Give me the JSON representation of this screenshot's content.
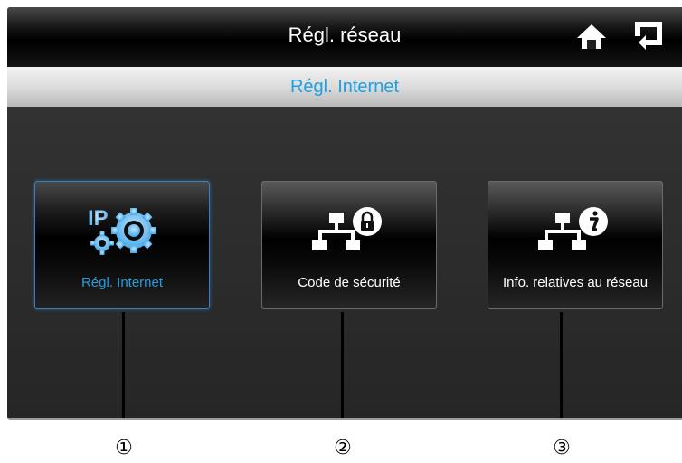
{
  "header": {
    "title": "Régl. réseau",
    "home_icon": "home-icon",
    "back_icon": "back-arrow-icon"
  },
  "subheader": {
    "title": "Régl. Internet"
  },
  "tiles": [
    {
      "label": "Régl. Internet",
      "icon": "ip-gear-icon",
      "selected": true
    },
    {
      "label": "Code de sécurité",
      "icon": "network-lock-icon",
      "selected": false
    },
    {
      "label": "Info. relatives au réseau",
      "icon": "network-info-icon",
      "selected": false
    }
  ],
  "callouts": [
    "①",
    "②",
    "③"
  ],
  "colors": {
    "accent": "#1e9fe0",
    "selected_border": "#3a7fb8",
    "background": "#2a2a2a"
  }
}
